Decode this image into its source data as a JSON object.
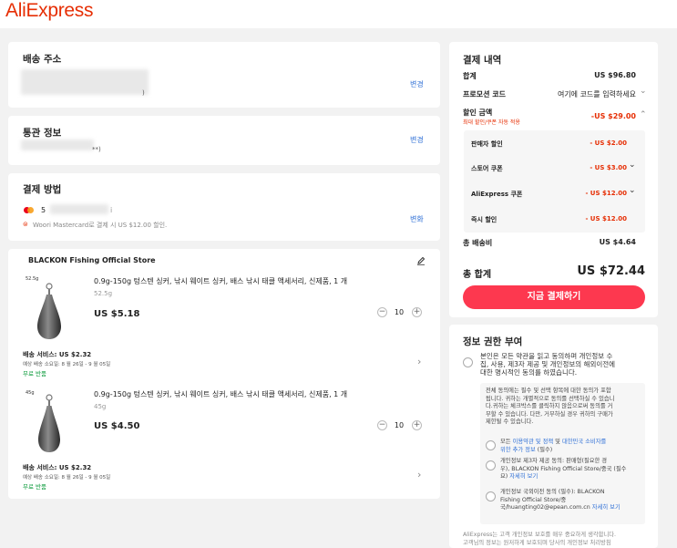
{
  "brand": {
    "logo_text": "AliExpress",
    "color": "#e62e04"
  },
  "shipping_address": {
    "title": "배송 주소",
    "change_label": "변경",
    "masked_tail": ")"
  },
  "customs_info": {
    "title": "통관 정보",
    "change_label": "변경",
    "masked_tail": "**)"
  },
  "payment_method": {
    "title": "결제 방법",
    "change_label": "변화",
    "card_prefix": "5",
    "card_tail": "i",
    "promo_text": "Woori Mastercard로 결제 시 US $12.00 할인."
  },
  "store": {
    "name": "BLACKON Fishing Official Store",
    "items": [
      {
        "thumb_label": "52.5g",
        "title": "0.9g-150g 텅스텐 싱커, 낚시 웨이트 싱커, 배스 낚시 태클 액세서리, 신제품, 1 개",
        "variant": "52.5g",
        "price": "US $5.18",
        "quantity": "10",
        "minus": "−",
        "plus": "+",
        "shipping_label": "배송 서비스:",
        "shipping_price": "US $2.32",
        "eta": "예상 배송 소요일: 8 월 26일 - 9 월 05일",
        "free_return": "무료 반품"
      },
      {
        "thumb_label": "45g",
        "title": "0.9g-150g 텅스텐 싱커, 낚시 웨이트 싱커, 배스 낚시 태클 액세서리, 신제품, 1 개",
        "variant": "45g",
        "price": "US $4.50",
        "quantity": "10",
        "minus": "−",
        "plus": "+",
        "shipping_label": "배송 서비스:",
        "shipping_price": "US $2.32",
        "eta": "예상 배송 소요일: 8 월 26일 - 9 월 05일",
        "free_return": "무료 반품"
      }
    ]
  },
  "summary": {
    "title": "결제 내역",
    "subtotal_label": "합계",
    "subtotal_value": "US $96.80",
    "promo_label": "프로모션 코드",
    "promo_placeholder": "여기에 코드를 입력하세요",
    "discount_label": "할인 금액",
    "discount_note": "최대 할인/쿠폰 자동 적용",
    "discount_value": "-US $29.00",
    "discounts": [
      {
        "label": "판매자 할인",
        "value": "- US $2.00"
      },
      {
        "label": "스토어 쿠폰",
        "value": "- US $3.00"
      },
      {
        "label": "AliExpress 쿠폰",
        "value": "- US $12.00"
      },
      {
        "label": "즉시 할인",
        "value": "- US $12.00"
      }
    ],
    "shipping_label": "총 배송비",
    "shipping_value": "US $4.64",
    "total_label": "총 합계",
    "total_value": "US $72.44",
    "pay_button": "지금 결제하기",
    "pay_color": "#fd384f"
  },
  "consent": {
    "title": "정보 권한 부여",
    "main_lines": [
      "본인은 모든 약관을 읽고 동의하며 개인정보 수",
      "집, 사용, 제3자 제공 및 개인정보의 해외이전에",
      "대한 명시적인 동의를 하였습니다."
    ],
    "detail_lines": [
      "전체 동의에는 필수 및 선택 항목에 대한 동의가 포함",
      "됩니다. 귀하는 개별적으로 동의를 선택하실 수 있습니",
      "다.귀하는 체크박스를 클릭하지 않음으로써 동의를 거",
      "부할 수 있습니다. 다만, 거부하실 경우 귀하의 구매가",
      "제한될 수 있습니다."
    ],
    "item1_a": "모든 ",
    "item1_link1": "이용약관 및 정책",
    "item1_b": " 및 ",
    "item1_link2": "대한민국 소비자를",
    "item1_link3": "위한 추가 정보",
    "item1_c": " (필수)",
    "item2_lines": [
      "개인정보 제3자 제공 동의: 판매형(필요한 경",
      "우), BLACKON Fishing Official Store/중국 (필수",
      "요) "
    ],
    "item2_link": "자세히 보기",
    "item3_lines": [
      "개인정보 국외이전 동의 (필수): BLACKON",
      "Fishing Official Store/중",
      "국/huangting02@epean.com.cn "
    ],
    "item3_link": "자세히 보기",
    "footer_lines": [
      "AliExpress는 고객 개인정보 보호를 매우 중요하게 생각합니다.",
      "고객님의 정보는 원저하게 보호되며 당사의 개인정보 처리방침"
    ]
  }
}
